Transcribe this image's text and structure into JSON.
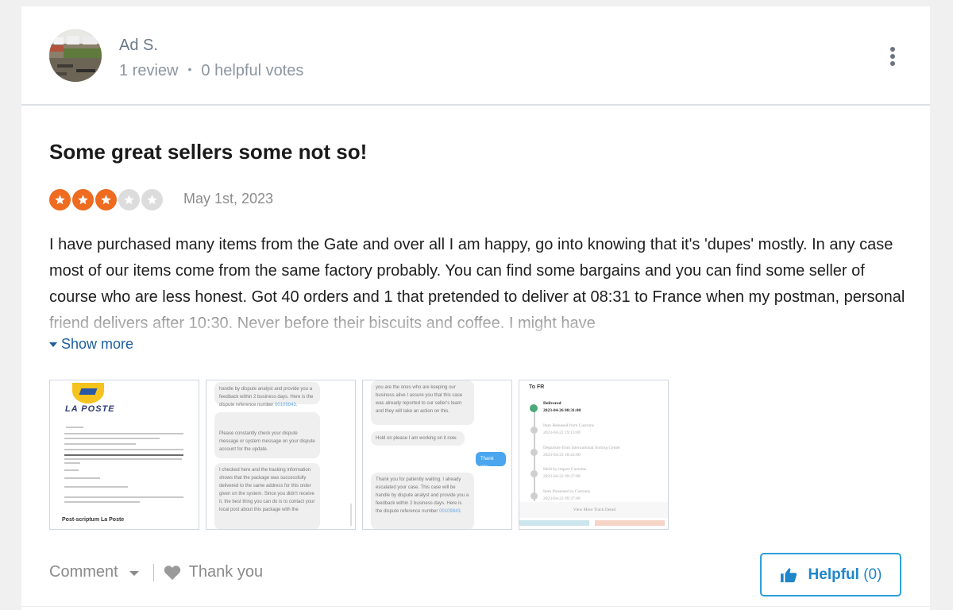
{
  "reviewer": {
    "name": "Ad S.",
    "reviews": "1 review",
    "separator": "•",
    "helpful_votes": "0 helpful votes",
    "avatar_icon": "user-avatar-photo",
    "menu_icon": "more-vertical-icon"
  },
  "review": {
    "title": "Some great sellers some not so!",
    "rating": 3,
    "rating_max": 5,
    "date": "May 1st, 2023",
    "body": "I have purchased many items from the Gate and over all I am happy, go into knowing that it's 'dupes' mostly. In any case most of our items come from the same factory probably. You can find some bargains and you can find some seller of course who are less honest. Got 40 orders and 1 that pretended to deliver at 08:31 to France when my postman, personal friend delivers after 10:30. Never before their biscuits and coffee. I might have",
    "show_more": "Show more"
  },
  "attachments": [
    {
      "kind": "letter",
      "logo_text": "LA POSTE",
      "signature": "Post-scriptum La Poste"
    },
    {
      "kind": "chat",
      "bubbles": [
        {
          "text": "handle by dispute analyst and provide you a feedback within 2 business days. Here is the dispute reference number",
          "link": "00109843."
        },
        {
          "text": "Please constantly check your dispute message or system message on your dispute account for the update."
        },
        {
          "text": "I checked here and the tracking information shows that the package was successfully delivered to the same address for this order given on the system. Since you didn't receive it, the best thing you can do is to contact your local post about this package with the"
        }
      ]
    },
    {
      "kind": "chat",
      "bubbles": [
        {
          "text": "you are the ones who are keeping our business alive I assure you that this case was already reported to our seller's team and they will take an action on this."
        },
        {
          "text": "Hold on please I am working on it now."
        },
        {
          "text": "Thank you",
          "outgoing": true
        },
        {
          "text": "Thank you for patiently waiting. I already escalated your case. This case will be handle by dispute analyst and provide you a feedback within 2 business days. Here is the dispute reference number",
          "link": "00109843."
        }
      ]
    },
    {
      "kind": "tracking",
      "title": "To FR",
      "events": [
        {
          "status": "Delivered",
          "time": "2023-04-26 08:31:00",
          "current": true
        },
        {
          "status": "Item Released from Customs",
          "time": "2023-04-22 19:13:00"
        },
        {
          "status": "Departure from International Sorting Center",
          "time": "2023-04-22 18:43:00"
        },
        {
          "status": "Held by import Customs",
          "time": "2023-04-22 09:37:00"
        },
        {
          "status": "Item Presented to Customs",
          "time": "2023-04-22 09:37:00"
        }
      ],
      "more": "View More Track Detail"
    }
  ],
  "footer": {
    "comment": "Comment",
    "thank_you": "Thank you",
    "helpful_label": "Helpful",
    "helpful_count": "(0)"
  },
  "colors": {
    "star_on": "#ee6b20",
    "star_off": "#dcdcdc",
    "link": "#1e5e9e",
    "helpful_accent": "#2e9fd8"
  }
}
